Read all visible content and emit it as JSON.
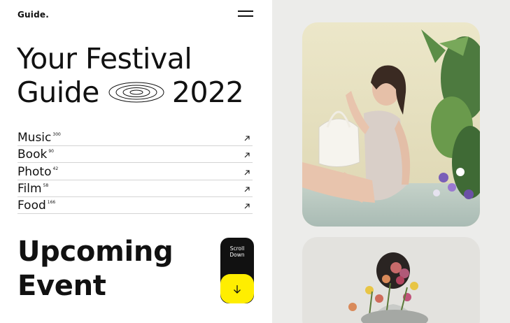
{
  "header": {
    "logo": "Guide.",
    "menu_icon": "hamburger-menu-icon"
  },
  "hero": {
    "line1": "Your Festival",
    "line2_word": "Guide",
    "year": "2022",
    "decor_icon": "concentric-rings-icon"
  },
  "categories": [
    {
      "name": "Music",
      "count": "300",
      "icon": "arrow-up-right-icon"
    },
    {
      "name": "Book",
      "count": "90",
      "icon": "arrow-up-right-icon"
    },
    {
      "name": "Photo",
      "count": "42",
      "icon": "arrow-up-right-icon"
    },
    {
      "name": "Film",
      "count": "58",
      "icon": "arrow-up-right-icon"
    },
    {
      "name": "Food",
      "count": "166",
      "icon": "arrow-up-right-icon"
    }
  ],
  "upcoming": {
    "line1": "Upcoming",
    "line2": "Event"
  },
  "scroll": {
    "line1": "Scroll",
    "line2": "Down",
    "icon": "arrow-down-icon"
  },
  "colors": {
    "accent": "#ffee00",
    "text": "#111111",
    "panel": "#ececea",
    "divider": "#d4d4d4"
  }
}
